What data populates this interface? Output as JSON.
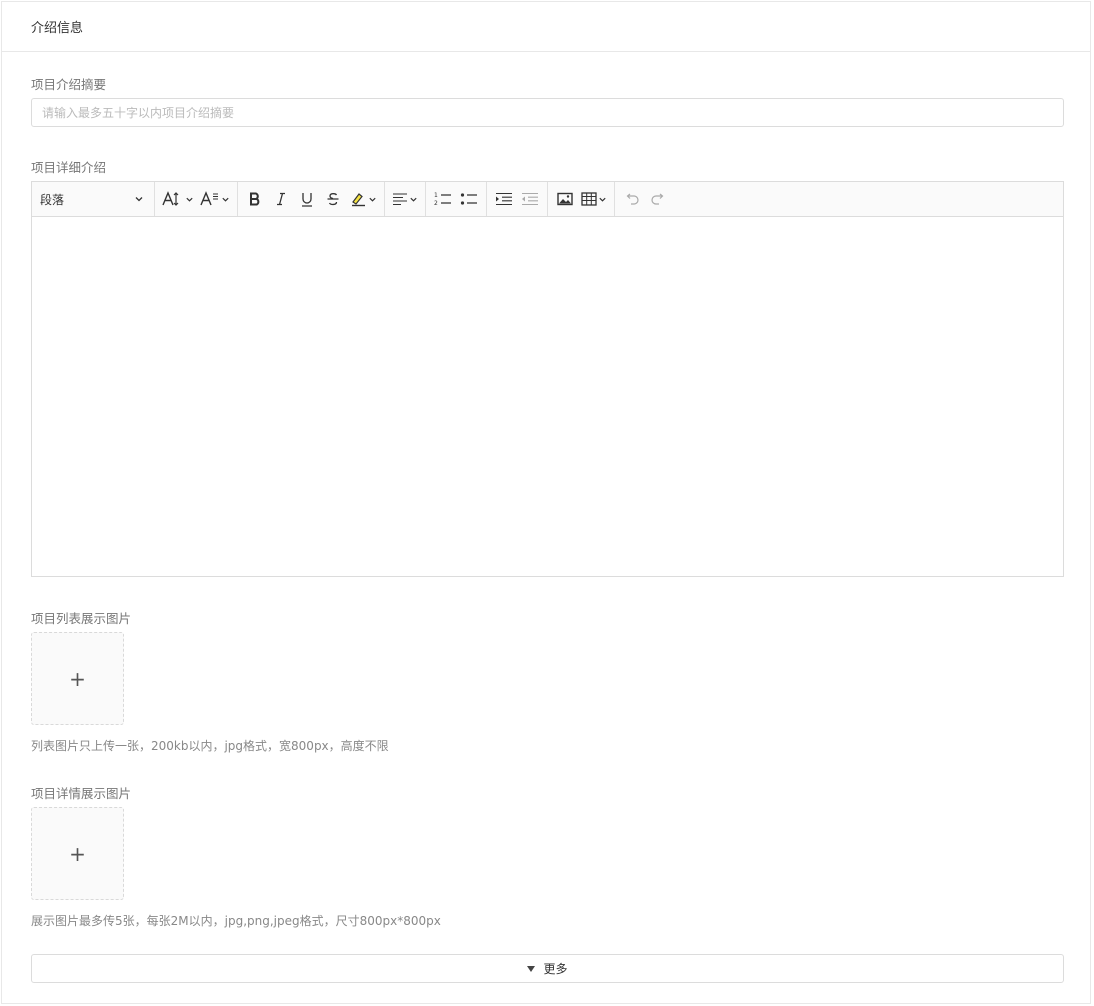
{
  "section": {
    "title": "介绍信息"
  },
  "summary": {
    "label": "项目介绍摘要",
    "value": "",
    "placeholder": "请输入最多五十字以内项目介绍摘要"
  },
  "detail": {
    "label": "项目详细介绍",
    "toolbar": {
      "paragraph_select": "段落",
      "icons": [
        "font-size-icon",
        "line-height-icon",
        "bold-icon",
        "italic-icon",
        "underline-icon",
        "strikethrough-icon",
        "highlight-icon",
        "align-icon",
        "ordered-list-icon",
        "bulleted-list-icon",
        "indent-icon",
        "outdent-icon",
        "image-icon",
        "table-icon",
        "undo-icon",
        "redo-icon"
      ]
    },
    "content": ""
  },
  "list_image": {
    "label": "项目列表展示图片",
    "upload_glyph": "+",
    "hint": "列表图片只上传一张，200kb以内，jpg格式，宽800px，高度不限"
  },
  "detail_image": {
    "label": "项目详情展示图片",
    "upload_glyph": "+",
    "hint": "展示图片最多传5张，每张2M以内，jpg,png,jpeg格式，尺寸800px*800px"
  },
  "more": {
    "label": "更多"
  },
  "colors": {
    "border": "#dcdcdc",
    "toolbar_bg": "#fafafa",
    "highlight": "#f5e342"
  }
}
